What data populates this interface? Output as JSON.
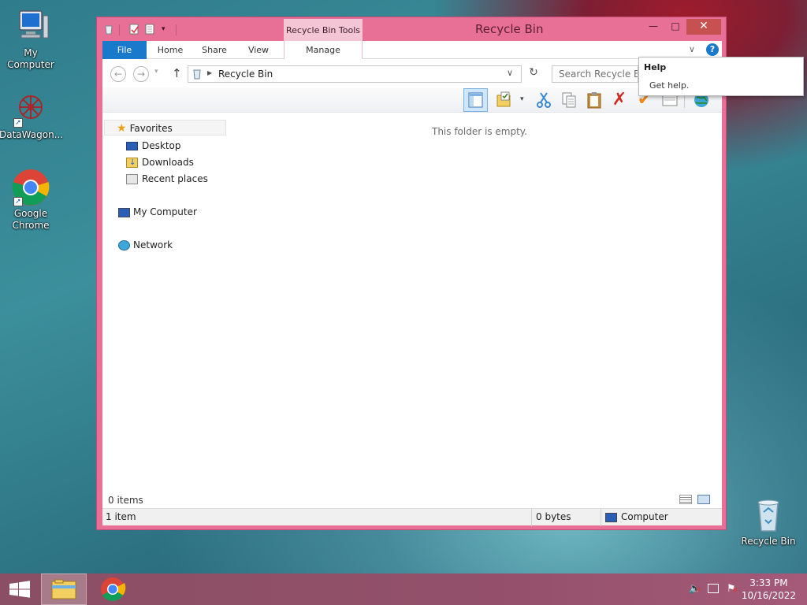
{
  "desktop": {
    "icons": [
      {
        "label": "My Computer",
        "icon": "computer-icon"
      },
      {
        "label": "DataWagon...",
        "icon": "datawagon-icon"
      },
      {
        "label": "Google Chrome",
        "icon": "chrome-icon"
      },
      {
        "label": "Recycle Bin",
        "icon": "recycle-bin-icon"
      }
    ]
  },
  "window": {
    "title": "Recycle Bin",
    "contextual_tab_group": "Recycle Bin Tools",
    "tabs": {
      "file": "File",
      "home": "Home",
      "share": "Share",
      "view": "View",
      "manage": "Manage"
    },
    "address": {
      "location": "Recycle Bin"
    },
    "search": {
      "placeholder": "Search Recycle Bin"
    },
    "nav": {
      "favorites": "Favorites",
      "desktop": "Desktop",
      "downloads": "Downloads",
      "recent_places": "Recent places",
      "my_computer": "My Computer",
      "network": "Network"
    },
    "content": {
      "empty_message": "This folder is empty."
    },
    "status": {
      "items": "0 items"
    },
    "details": {
      "selection": "1 item",
      "size": "0 bytes",
      "location": "Computer"
    }
  },
  "help_tooltip": {
    "title": "Help",
    "text": "Get help."
  },
  "taskbar": {
    "time": "3:33 PM",
    "date": "10/16/2022"
  },
  "colors": {
    "window_frame": "#e86f96",
    "file_tab": "#1979ca",
    "taskbar": "#8a4f64",
    "close_button": "#c75050"
  }
}
